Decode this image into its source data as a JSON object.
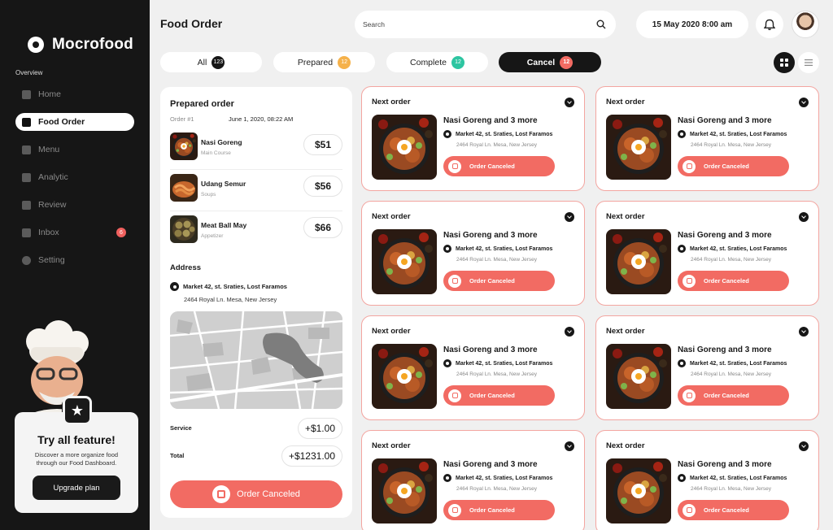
{
  "app": {
    "name": "Mocrofood"
  },
  "sidebar": {
    "section": "Overview",
    "items": [
      {
        "label": "Home",
        "icon": "home-icon",
        "active": false
      },
      {
        "label": "Food Order",
        "icon": "food-order-icon",
        "active": true
      },
      {
        "label": "Menu",
        "icon": "menu-icon",
        "active": false
      },
      {
        "label": "Analytic",
        "icon": "analytic-icon",
        "active": false
      },
      {
        "label": "Review",
        "icon": "review-icon",
        "active": false
      },
      {
        "label": "Inbox",
        "icon": "inbox-icon",
        "active": false,
        "badge": "6"
      },
      {
        "label": "Setting",
        "icon": "gear-icon",
        "active": false
      }
    ],
    "promo": {
      "title": "Try all feature!",
      "description": "Discover a more organize food through our Food Dashboard.",
      "button": "Upgrade plan"
    }
  },
  "header": {
    "title": "Food Order",
    "search_placeholder": "Search",
    "date": "15 May 2020 8:00 am"
  },
  "tabs": [
    {
      "label": "All",
      "count": "123",
      "color": "#161616",
      "active": false
    },
    {
      "label": "Prepared",
      "count": "12",
      "color": "#f5b14a",
      "active": false
    },
    {
      "label": "Complete",
      "count": "12",
      "color": "#2dc5a1",
      "active": false
    },
    {
      "label": "Cancel",
      "count": "12",
      "color": "#f26b63",
      "active": true
    }
  ],
  "detail": {
    "title": "Prepared order",
    "order_no": "Order #1",
    "order_date": "June 1, 2020, 08:22 AM",
    "items": [
      {
        "name": "Nasi Goreng",
        "category": "Main Course",
        "price": "$51"
      },
      {
        "name": "Udang Semur",
        "category": "Soups",
        "price": "$56"
      },
      {
        "name": "Meat Ball May",
        "category": "Appetizer",
        "price": "$66"
      }
    ],
    "address_label": "Address",
    "address_line1": "Market 42, st. Sraties, Lost Faramos",
    "address_line2": "2464 Royal Ln. Mesa, New Jersey",
    "service_label": "Service",
    "service_value": "+$1.00",
    "total_label": "Total",
    "total_value": "+$1231.00",
    "cancel_button": "Order Canceled"
  },
  "cards": [
    {
      "label": "Next order",
      "title": "Nasi Goreng and 3 more",
      "address": "Market 42, st. Sraties, Lost Faramos",
      "sub": "2464 Royal Ln. Mesa, New Jersey",
      "button": "Order Canceled"
    },
    {
      "label": "Next order",
      "title": "Nasi Goreng and 3 more",
      "address": "Market 42, st. Sraties, Lost Faramos",
      "sub": "2464 Royal Ln. Mesa, New Jersey",
      "button": "Order Canceled"
    },
    {
      "label": "Next order",
      "title": "Nasi Goreng and 3 more",
      "address": "Market 42, st. Sraties, Lost Faramos",
      "sub": "2464 Royal Ln. Mesa, New Jersey",
      "button": "Order Canceled"
    },
    {
      "label": "Next order",
      "title": "Nasi Goreng and 3 more",
      "address": "Market 42, st. Sraties, Lost Faramos",
      "sub": "2464 Royal Ln. Mesa, New Jersey",
      "button": "Order Canceled"
    },
    {
      "label": "Next order",
      "title": "Nasi Goreng and 3 more",
      "address": "Market 42, st. Sraties, Lost Faramos",
      "sub": "2464 Royal Ln. Mesa, New Jersey",
      "button": "Order Canceled"
    },
    {
      "label": "Next order",
      "title": "Nasi Goreng and 3 more",
      "address": "Market 42, st. Sraties, Lost Faramos",
      "sub": "2464 Royal Ln. Mesa, New Jersey",
      "button": "Order Canceled"
    },
    {
      "label": "Next order",
      "title": "Nasi Goreng and 3 more",
      "address": "Market 42, st. Sraties, Lost Faramos",
      "sub": "2464 Royal Ln. Mesa, New Jersey",
      "button": "Order Canceled"
    },
    {
      "label": "Next order",
      "title": "Nasi Goreng and 3 more",
      "address": "Market 42, st. Sraties, Lost Faramos",
      "sub": "2464 Royal Ln. Mesa, New Jersey",
      "button": "Order Canceled"
    }
  ],
  "colors": {
    "accent": "#f26b63",
    "dark": "#161616",
    "background": "#f0f0f0"
  }
}
